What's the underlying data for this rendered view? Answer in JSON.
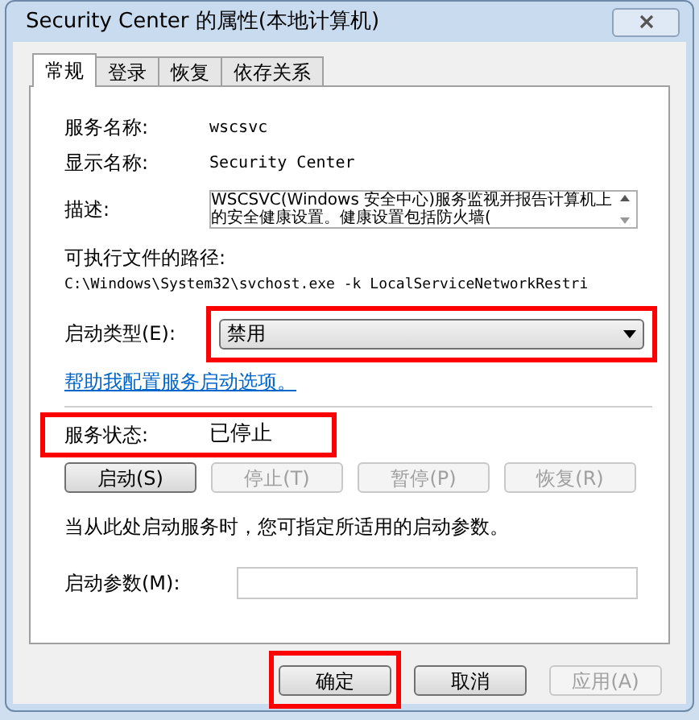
{
  "window": {
    "title": "Security Center 的属性(本地计算机)"
  },
  "tabs": [
    {
      "label": "常规",
      "selected": true
    },
    {
      "label": "登录",
      "selected": false
    },
    {
      "label": "恢复",
      "selected": false
    },
    {
      "label": "依存关系",
      "selected": false
    }
  ],
  "service_name": {
    "label": "服务名称:",
    "value": "wscsvc"
  },
  "display_name": {
    "label": "显示名称:",
    "value": "Security Center"
  },
  "description": {
    "label": "描述:",
    "value": "WSCSVC(Windows 安全中心)服务监视并报告计算机上的安全健康设置。健康设置包括防火墙("
  },
  "executable_path": {
    "label": "可执行文件的路径:",
    "value": "C:\\Windows\\System32\\svchost.exe -k LocalServiceNetworkRestri"
  },
  "startup_type": {
    "label": "启动类型(E):",
    "value": "禁用",
    "highlighted": true
  },
  "help_link": "帮助我配置服务启动选项。",
  "service_status": {
    "label": "服务状态:",
    "value": "已停止",
    "highlighted": true
  },
  "service_buttons": [
    {
      "label": "启动(S)",
      "disabled": false
    },
    {
      "label": "停止(T)",
      "disabled": true
    },
    {
      "label": "暂停(P)",
      "disabled": true
    },
    {
      "label": "恢复(R)",
      "disabled": true
    }
  ],
  "start_note": "当从此处启动服务时，您可指定所适用的启动参数。",
  "start_parameters": {
    "label": "启动参数(M):"
  },
  "dialog_buttons": [
    {
      "label": "确定",
      "disabled": false,
      "highlighted": true
    },
    {
      "label": "取消",
      "disabled": false,
      "highlighted": false
    },
    {
      "label": "应用(A)",
      "disabled": true,
      "highlighted": false
    }
  ]
}
